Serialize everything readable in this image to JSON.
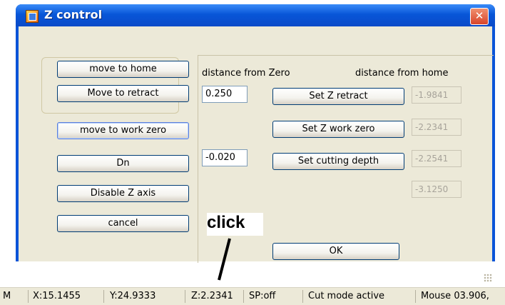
{
  "window": {
    "title": "Z control",
    "close_glyph": "✕",
    "app_icon": "window-app-icon"
  },
  "left_buttons": {
    "move_to_home": "move to home",
    "move_to_retract": "Move to retract",
    "move_to_work_zero": "move to work zero",
    "dn": "Dn",
    "disable_z_axis": "Disable Z axis",
    "cancel": "cancel"
  },
  "labels": {
    "distance_from_zero": "distance from Zero",
    "distance_from_home": "distance from home"
  },
  "inputs": {
    "retract_value": "0.250",
    "cutting_depth_value": "-0.020"
  },
  "set_buttons": {
    "set_z_retract": "Set Z retract",
    "set_z_work_zero": "Set Z work zero",
    "set_cutting_depth": "Set cutting depth",
    "ok": "OK"
  },
  "readouts": {
    "retract_home": "-1.9841",
    "work_zero_home": "-2.2341",
    "cutting_depth_home": "-2.2541",
    "extra_home": "-3.1250"
  },
  "annotation": {
    "text": "click"
  },
  "statusbar": {
    "cells": [
      "M",
      "X:15.1455",
      "Y:24.9333",
      "Z:2.2341",
      "SP:off",
      "Cut mode active",
      "Mouse 03.906,"
    ]
  }
}
